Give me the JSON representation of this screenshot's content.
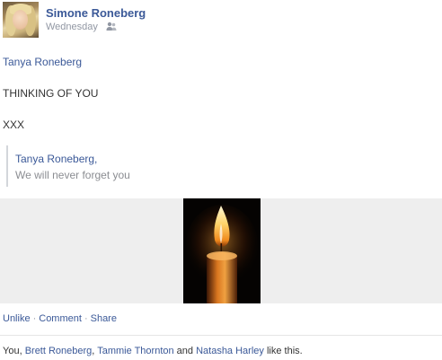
{
  "post": {
    "author": "Simone Roneberg",
    "timestamp": "Wednesday",
    "audience_icon": "friends-icon",
    "mention": "Tanya Roneberg",
    "line2": "THINKING OF YOU",
    "line3": "XXX"
  },
  "quote": {
    "name": "Tanya Roneberg,",
    "text": "We will never forget you"
  },
  "media": {
    "icon": "candle-photo"
  },
  "actions": {
    "unlike": "Unlike",
    "comment": "Comment",
    "share": "Share",
    "separator": "·"
  },
  "likes": {
    "prefix": "You, ",
    "person1": "Brett Roneberg",
    "comma": ", ",
    "person2": "Tammie Thornton",
    "and": " and ",
    "person3": "Natasha Harley",
    "suffix": " like this."
  },
  "colors": {
    "link": "#3b5998",
    "muted": "#9197a3",
    "media_bg": "#eeeeee"
  }
}
